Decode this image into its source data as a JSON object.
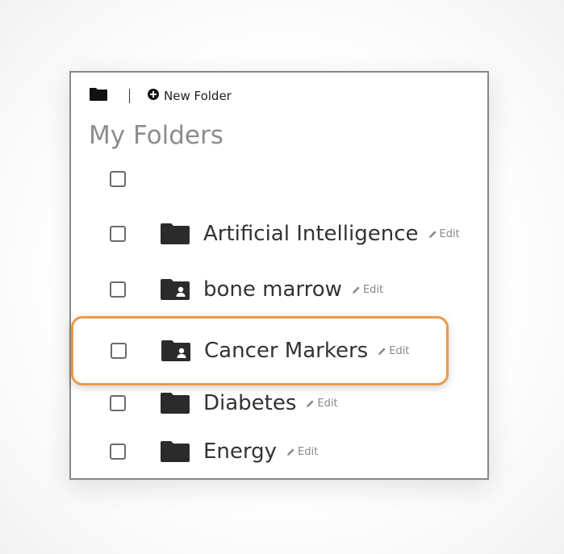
{
  "toolbar": {
    "new_folder_label": "New Folder"
  },
  "panel": {
    "title": "My Folders"
  },
  "folders": [
    {
      "name": "Artificial Intelligence",
      "icon": "folder-icon",
      "edit_label": "Edit"
    },
    {
      "name": "bone marrow",
      "icon": "shared-folder-icon",
      "edit_label": "Edit"
    },
    {
      "name": "Cancer Markers",
      "icon": "shared-folder-icon",
      "edit_label": "Edit",
      "highlighted": true
    },
    {
      "name": "Diabetes",
      "icon": "folder-icon",
      "edit_label": "Edit"
    },
    {
      "name": "Energy",
      "icon": "folder-icon",
      "edit_label": "Edit"
    }
  ],
  "colors": {
    "highlight_border": "#eb9a47",
    "title_gray": "#8c8c8c",
    "icon_dark": "#2b2b2b"
  }
}
